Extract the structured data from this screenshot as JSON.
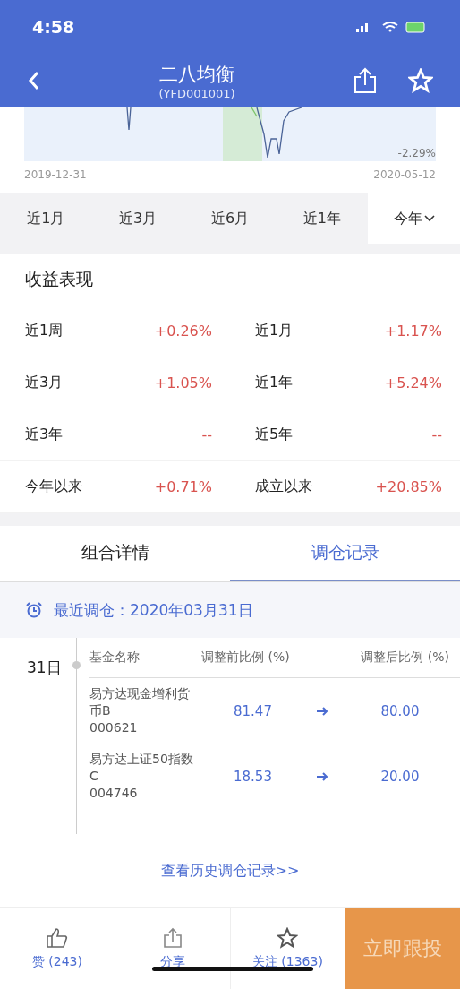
{
  "status_bar": {
    "time": "4:58"
  },
  "nav": {
    "title": "二八均衡",
    "code": "(YFD001001)"
  },
  "chart": {
    "y_label": "-2.29%",
    "start_date": "2019-12-31",
    "end_date": "2020-05-12"
  },
  "periods": [
    {
      "label": "近1月",
      "selected": false
    },
    {
      "label": "近3月",
      "selected": false
    },
    {
      "label": "近6月",
      "selected": false
    },
    {
      "label": "近1年",
      "selected": false
    },
    {
      "label": "今年",
      "selected": true
    }
  ],
  "returns": {
    "title": "收益表现",
    "items": [
      {
        "label": "近1周",
        "value": "+0.26%"
      },
      {
        "label": "近1月",
        "value": "+1.17%"
      },
      {
        "label": "近3月",
        "value": "+1.05%"
      },
      {
        "label": "近1年",
        "value": "+5.24%"
      },
      {
        "label": "近3年",
        "value": "--"
      },
      {
        "label": "近5年",
        "value": "--"
      },
      {
        "label": "今年以来",
        "value": "+0.71%"
      },
      {
        "label": "成立以来",
        "value": "+20.85%"
      }
    ]
  },
  "tabs": [
    {
      "label": "组合详情",
      "selected": false
    },
    {
      "label": "调仓记录",
      "selected": true
    }
  ],
  "latest": "最近调仓：2020年03月31日",
  "record": {
    "day": "31日",
    "columns": [
      "基金名称",
      "调整前比例 (%)",
      "调整后比例 (%)"
    ],
    "rows": [
      {
        "name": "易方达现金增利货币B",
        "code": "000621",
        "before": "81.47",
        "after": "80.00"
      },
      {
        "name": "易方达上证50指数C",
        "code": "004746",
        "before": "18.53",
        "after": "20.00"
      }
    ]
  },
  "history_link": "查看历史调仓记录>>",
  "bottom_bar": {
    "like": "赞 (243)",
    "share": "分享",
    "follow": "关注 (1363)",
    "action": "立即跟投"
  }
}
